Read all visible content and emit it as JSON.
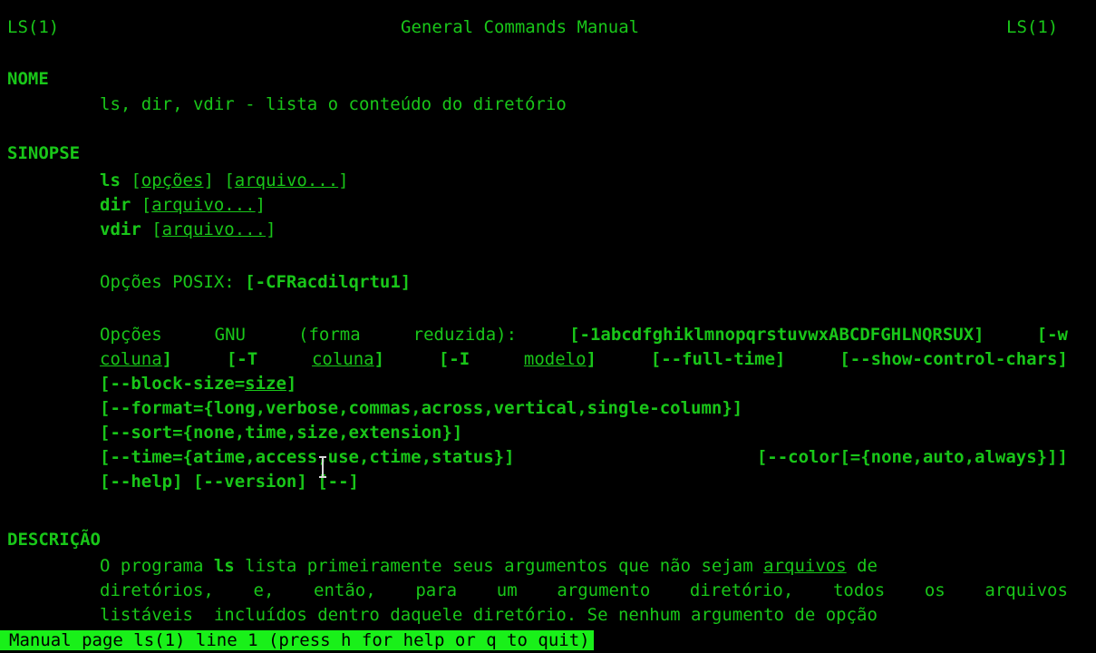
{
  "header": {
    "left": "LS(1)",
    "center": "General Commands Manual",
    "right": "LS(1)"
  },
  "nome": {
    "title": "NOME",
    "text": "ls, dir, vdir - lista o conteúdo do diretório"
  },
  "sinopse": {
    "title": "SINOPSE",
    "l1": {
      "cmd": "ls",
      "a": "[",
      "opt": "opções",
      "b": "] [",
      "file": "arquivo...",
      "c": "]"
    },
    "l2": {
      "cmd": "dir",
      "a": "[",
      "file": "arquivo...",
      "c": "]"
    },
    "l3": {
      "cmd": "vdir",
      "a": "[",
      "file": "arquivo...",
      "c": "]"
    },
    "posix": {
      "label": "Opções POSIX:",
      "opts": "[-CFRacdilqrtu1]"
    },
    "gnu1": {
      "w1": "Opções",
      "w2": "GNU",
      "w3": "(forma",
      "w4": "reduzida):",
      "w5": "[-1abcdfghiklmnopqrstuvwxABCDFGHLNQRSUX]",
      "w6": "[-w"
    },
    "gnu2": {
      "w1": "coluna",
      "w1b": "]",
      "w2a": "[-T",
      "w2": "coluna",
      "w2b": "]",
      "w3a": "[-I",
      "w3": "modelo",
      "w3b": "]",
      "w4": "[--full-time]",
      "w5": "[--show-control-chars]"
    },
    "gnu3": {
      "a": "[--block-size=",
      "u": "size",
      "b": "]"
    },
    "gnu4": "[--format={long,verbose,commas,across,vertical,single-column}]",
    "gnu5": "[--sort={none,time,size,extension}]",
    "gnu6": {
      "w1": "[--time={atime,access,use,ctime,status}]",
      "w2": "[--color[={none,auto,always}]]"
    },
    "gnu7": "[--help] [--version] [--]"
  },
  "descricao": {
    "title": "DESCRIÇÃO",
    "l1": {
      "a": "O programa ",
      "b": "ls",
      "c": " lista primeiramente seus argumentos que não sejam ",
      "d": "arquivos",
      "e": " de"
    },
    "l2": [
      "diretórios,",
      "e,",
      "então,",
      "para",
      "um",
      "argumento",
      "diretório,",
      "todos",
      "os",
      "arquivos"
    ],
    "l3": "listáveis  incluídos dentro daquele diretório. Se nenhum argumento de opção"
  },
  "status_bar": "Manual page ls(1) line 1 (press h for help or q to quit)",
  "colors": {
    "foreground": "#19c619",
    "background": "#000000",
    "status_bg": "#19f019"
  }
}
